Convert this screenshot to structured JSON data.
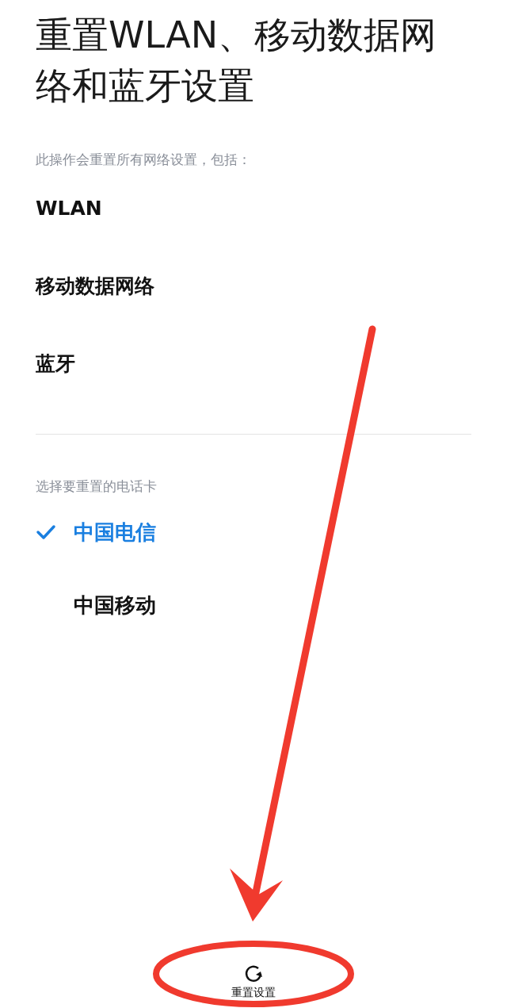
{
  "title": "重置WLAN、移动数据网络和蓝牙设置",
  "description": "此操作会重置所有网络设置，包括：",
  "items": [
    "WLAN",
    "移动数据网络",
    "蓝牙"
  ],
  "sim_section": {
    "label": "选择要重置的电话卡",
    "options": [
      {
        "label": "中国电信",
        "selected": true
      },
      {
        "label": "中国移动",
        "selected": false
      }
    ]
  },
  "reset_button": {
    "label": "重置设置"
  }
}
